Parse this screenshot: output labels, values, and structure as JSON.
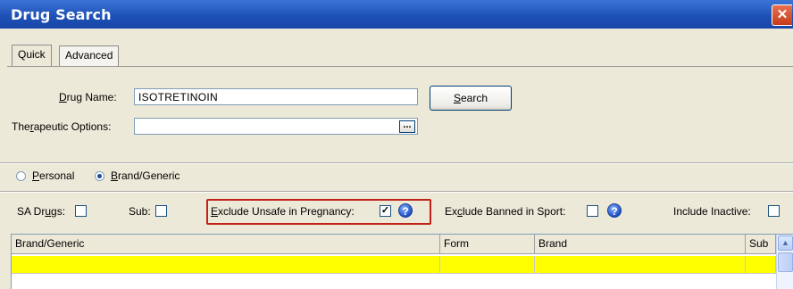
{
  "window": {
    "title": "Drug Search",
    "close_glyph": "✕"
  },
  "tabs": [
    {
      "label": "Quick",
      "active": true
    },
    {
      "label": "Advanced",
      "active": false
    }
  ],
  "drug_name": {
    "label_pre": "",
    "label_u": "D",
    "label_post": "rug Name:",
    "value": "ISOTRETINOIN"
  },
  "therapeutic": {
    "label_pre": "The",
    "label_u": "r",
    "label_post": "apeutic Options:",
    "value": "",
    "browse_label": "..."
  },
  "search_button": {
    "label_u": "S",
    "label_post": "earch"
  },
  "source": {
    "personal": {
      "label_u": "P",
      "label_post": "ersonal",
      "selected": false
    },
    "brand_generic": {
      "label_u": "B",
      "label_post": "rand/Generic",
      "selected": true
    }
  },
  "filters": {
    "sa_drugs": {
      "label_pre": "SA Dr",
      "label_u": "u",
      "label_post": "gs:",
      "checked": false
    },
    "sub": {
      "label": "Sub:",
      "checked": false
    },
    "exclude_pregnancy": {
      "label_pre": "",
      "label_u": "E",
      "label_post": "xclude Unsafe in Pregnancy:",
      "checked": true,
      "check_glyph": "✓"
    },
    "exclude_sport": {
      "label_pre": "Ex",
      "label_u": "c",
      "label_post": "lude Banned in Sport:",
      "checked": false
    },
    "include_inactive": {
      "label": "Include Inactive:",
      "checked": false
    },
    "help_glyph": "?"
  },
  "results": {
    "columns": [
      "Brand/Generic",
      "Form",
      "Brand",
      "Sub"
    ],
    "rows": [
      [
        "",
        "",
        "",
        ""
      ]
    ],
    "highlight_color": "#ffff00"
  },
  "scroll_up_glyph": "▲"
}
